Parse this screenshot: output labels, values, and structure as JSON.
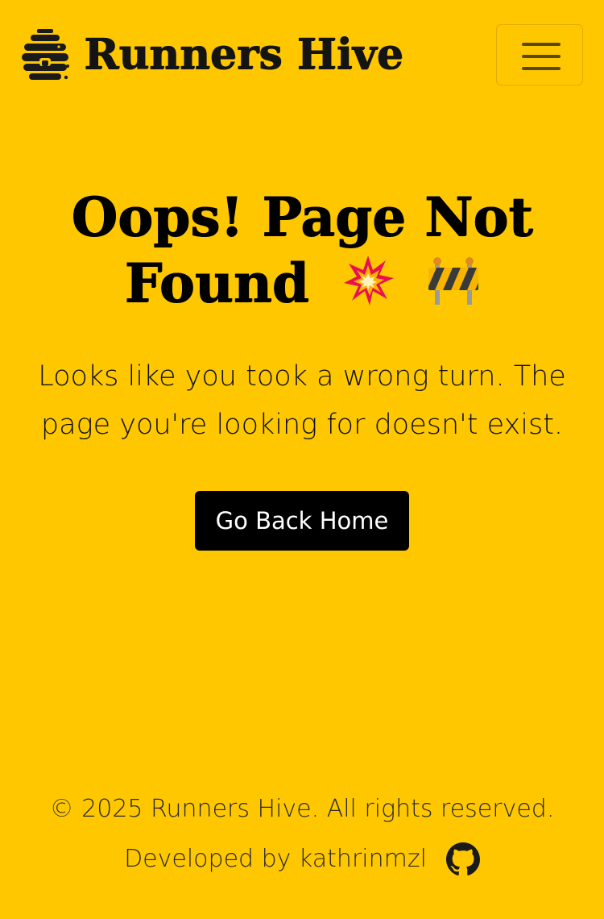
{
  "navbar": {
    "brand_name": "Runners Hive",
    "logo_icon": "beehive-icon",
    "menu_icon": "hamburger-menu-icon"
  },
  "main": {
    "title": "Oops! Page Not Found",
    "title_emojis": [
      "💥",
      "🚧"
    ],
    "message": "Looks like you took a wrong turn. The page you're looking for doesn't exist.",
    "home_button_label": "Go Back Home"
  },
  "footer": {
    "copyright": "© 2025 Runners Hive. All rights reserved.",
    "developed_by": "Developed by kathrinmzl",
    "github_icon": "github-icon"
  },
  "colors": {
    "background": "#ffc700",
    "button": "#000000",
    "button_text": "#ffffff"
  }
}
